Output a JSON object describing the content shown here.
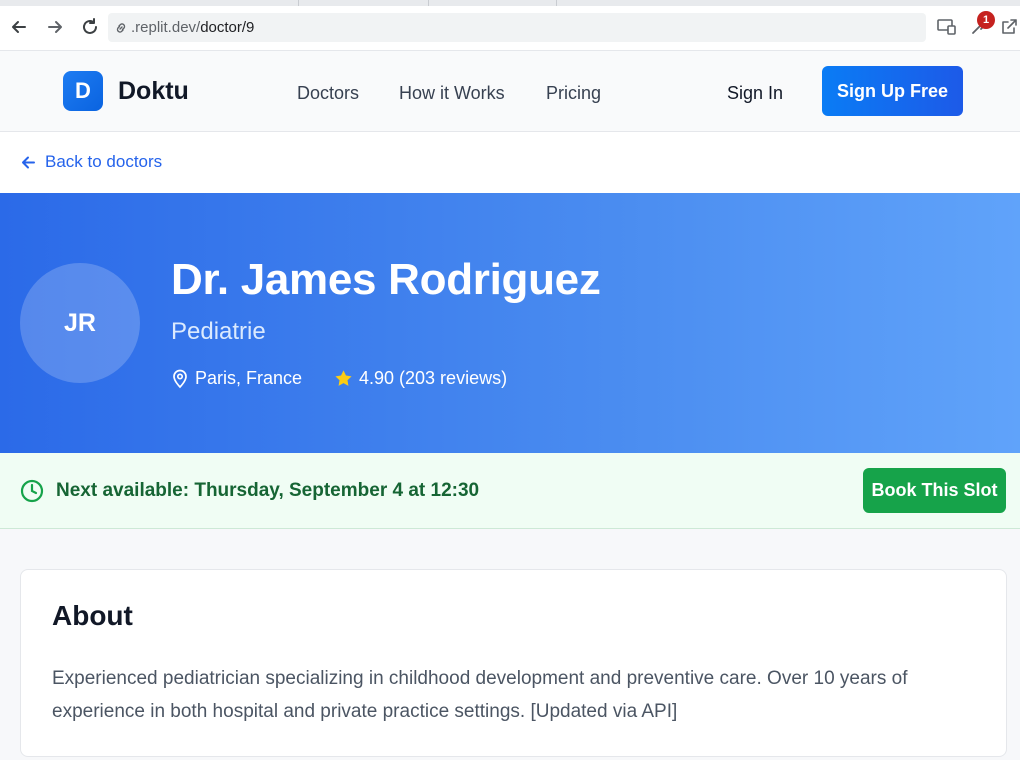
{
  "browser": {
    "url_prefix": ".replit.dev/",
    "url_path": "doctor/9",
    "extension_badge": "1"
  },
  "header": {
    "logo_letter": "D",
    "brand": "Doktu",
    "nav": [
      "Doctors",
      "How it Works",
      "Pricing"
    ],
    "sign_in": "Sign In",
    "sign_up": "Sign Up Free"
  },
  "back": {
    "label": "Back to doctors"
  },
  "doctor": {
    "initials": "JR",
    "name": "Dr. James Rodriguez",
    "specialty": "Pediatrie",
    "location": "Paris, France",
    "rating": "4.90 (203 reviews)"
  },
  "availability": {
    "text": "Next available: Thursday, September 4 at 12:30",
    "button": "Book This Slot"
  },
  "about": {
    "title": "About",
    "body": "Experienced pediatrician specializing in childhood development and preventive care. Over 10 years of experience in both hospital and private practice settings. [Updated via API]"
  },
  "colors": {
    "accent": "#2563eb",
    "hero_start": "#2b6ae8",
    "hero_end": "#60a3fa",
    "success": "#16a34a",
    "star": "#facc15"
  }
}
